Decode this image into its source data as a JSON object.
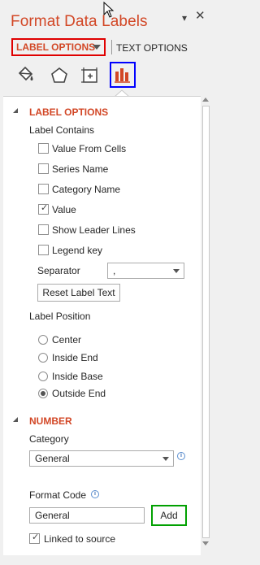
{
  "pane": {
    "title": "Format Data Labels",
    "dropdown_glyph": "▾",
    "close_glyph": "✕"
  },
  "tabs": {
    "label_options": "LABEL OPTIONS",
    "text_options": "TEXT OPTIONS"
  },
  "icon_tabs": [
    "fill-line-icon",
    "effects-icon",
    "size-properties-icon",
    "label-options-icon"
  ],
  "label_options_section": {
    "heading": "LABEL OPTIONS",
    "label_contains": "Label Contains",
    "checkboxes": [
      {
        "label": "Value From Cells",
        "checked": false
      },
      {
        "label": "Series Name",
        "checked": false
      },
      {
        "label": "Category Name",
        "checked": false
      },
      {
        "label": "Value",
        "checked": true
      },
      {
        "label": "Show Leader Lines",
        "checked": false
      },
      {
        "label": "Legend key",
        "checked": false
      }
    ],
    "separator_label": "Separator",
    "separator_value": ",",
    "reset_button": "Reset Label Text",
    "label_position": "Label Position",
    "positions": [
      {
        "label": "Center",
        "selected": false
      },
      {
        "label": "Inside End",
        "selected": false
      },
      {
        "label": "Inside Base",
        "selected": false
      },
      {
        "label": "Outside End",
        "selected": true
      }
    ]
  },
  "number_section": {
    "heading": "NUMBER",
    "category_label": "Category",
    "category_value": "General",
    "format_code_label": "Format Code",
    "format_code_value": "General",
    "add_button": "Add",
    "linked_label": "Linked to source",
    "linked_checked": true
  },
  "colors": {
    "accent": "#d24726",
    "red_highlight": "#e00000",
    "blue_highlight": "#0000ff",
    "green_highlight": "#00a000"
  }
}
